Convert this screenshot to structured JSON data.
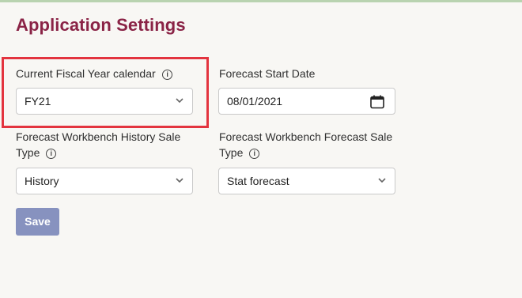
{
  "page": {
    "title": "Application Settings"
  },
  "fiscal_year": {
    "label": "Current Fiscal Year calendar",
    "value": "FY21",
    "info_symbol": "i"
  },
  "forecast_start": {
    "label": "Forecast Start Date",
    "value": "08/01/2021"
  },
  "history_sale": {
    "label_line1": "Forecast Workbench History Sale",
    "label_line2": "Type",
    "value": "History",
    "info_symbol": "i"
  },
  "forecast_sale": {
    "label_line1": "Forecast Workbench Forecast Sale",
    "label_line2": "Type",
    "value": "Stat forecast",
    "info_symbol": "i"
  },
  "actions": {
    "save_label": "Save"
  },
  "colors": {
    "title": "#8a2346",
    "highlight": "#e3343f",
    "save_button": "#8792bf"
  }
}
